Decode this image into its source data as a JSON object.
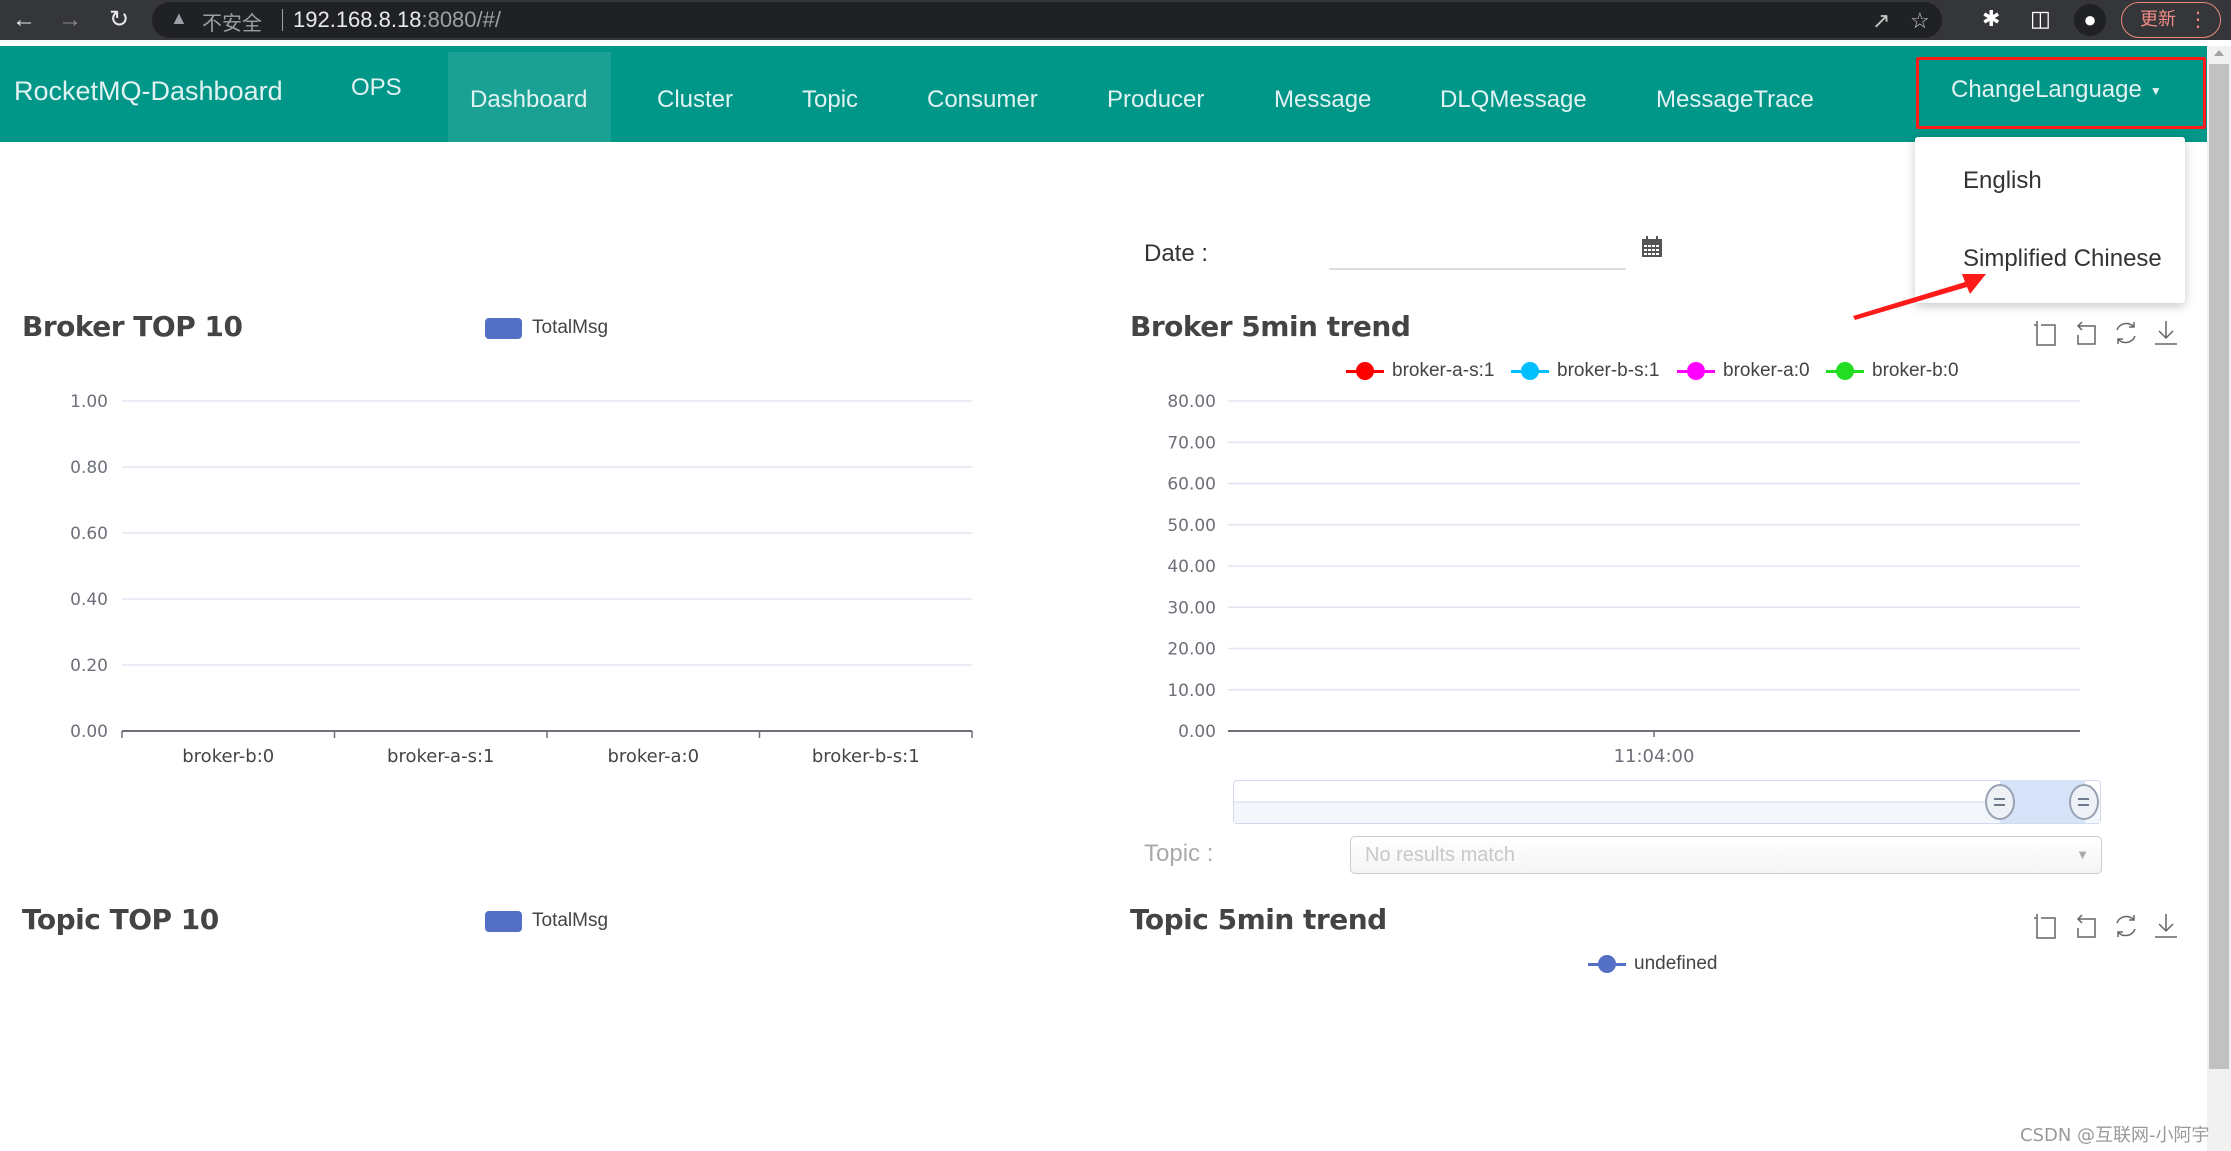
{
  "browser": {
    "insecure_label": "不安全",
    "url_host": "192.168.8.18",
    "url_path": ":8080/#/",
    "update_label": "更新"
  },
  "navbar": {
    "brand": "RocketMQ-Dashboard",
    "items": [
      {
        "label": "OPS",
        "active": false
      },
      {
        "label": "Dashboard",
        "active": true
      },
      {
        "label": "Cluster",
        "active": false
      },
      {
        "label": "Topic",
        "active": false
      },
      {
        "label": "Consumer",
        "active": false
      },
      {
        "label": "Producer",
        "active": false
      },
      {
        "label": "Message",
        "active": false
      },
      {
        "label": "DLQMessage",
        "active": false
      },
      {
        "label": "MessageTrace",
        "active": false
      }
    ],
    "language_toggle": "ChangeLanguage"
  },
  "language_menu": {
    "options": [
      "English",
      "Simplified Chinese"
    ],
    "highlight_color": "#ff1a1a"
  },
  "filters": {
    "date_label": "Date :",
    "date_value": "",
    "topic_label": "Topic :",
    "topic_placeholder": "No results match"
  },
  "sections": {
    "broker_top10": "Broker TOP 10",
    "broker_trend": "Broker 5min trend",
    "topic_top10": "Topic TOP 10",
    "topic_trend": "Topic 5min trend"
  },
  "colors": {
    "primary": "#009688",
    "bar": "#5470c6"
  },
  "chart_data": [
    {
      "id": "broker_top10",
      "type": "bar",
      "title": "Broker TOP 10",
      "legend": [
        "TotalMsg"
      ],
      "legend_position": "top-center",
      "categories": [
        "broker-b:0",
        "broker-a-s:1",
        "broker-a:0",
        "broker-b-s:1"
      ],
      "series": [
        {
          "name": "TotalMsg",
          "color": "#5470c6",
          "values": [
            0,
            0,
            0,
            0
          ]
        }
      ],
      "yticks": [
        "0.00",
        "0.20",
        "0.40",
        "0.60",
        "0.80",
        "1.00"
      ],
      "ylim": [
        0,
        1
      ],
      "grid": true
    },
    {
      "id": "broker_trend",
      "type": "line",
      "title": "Broker 5min trend",
      "legend_position": "top-center",
      "series": [
        {
          "name": "broker-a-s:1",
          "color": "#ff0000",
          "values": []
        },
        {
          "name": "broker-b-s:1",
          "color": "#00bfff",
          "values": []
        },
        {
          "name": "broker-a:0",
          "color": "#ff00ff",
          "values": []
        },
        {
          "name": "broker-b:0",
          "color": "#22dd22",
          "values": []
        }
      ],
      "x": [
        "11:04:00"
      ],
      "yticks": [
        "0.00",
        "10.00",
        "20.00",
        "30.00",
        "40.00",
        "50.00",
        "60.00",
        "70.00",
        "80.00"
      ],
      "ylim": [
        0,
        80
      ],
      "grid": true,
      "datazoom_range": [
        0.9,
        1.0
      ],
      "toolbox": [
        "zoom",
        "zoom-reset",
        "restore",
        "save-image"
      ]
    },
    {
      "id": "topic_top10",
      "type": "bar",
      "title": "Topic TOP 10",
      "legend": [
        "TotalMsg"
      ],
      "series": [
        {
          "name": "TotalMsg",
          "color": "#5470c6",
          "values": []
        }
      ]
    },
    {
      "id": "topic_trend",
      "type": "line",
      "title": "Topic 5min trend",
      "series": [
        {
          "name": "undefined",
          "color": "#5470c6",
          "values": []
        }
      ],
      "toolbox": [
        "zoom",
        "zoom-reset",
        "restore",
        "save-image"
      ]
    }
  ],
  "watermark": "CSDN @互联网-小阿宇"
}
